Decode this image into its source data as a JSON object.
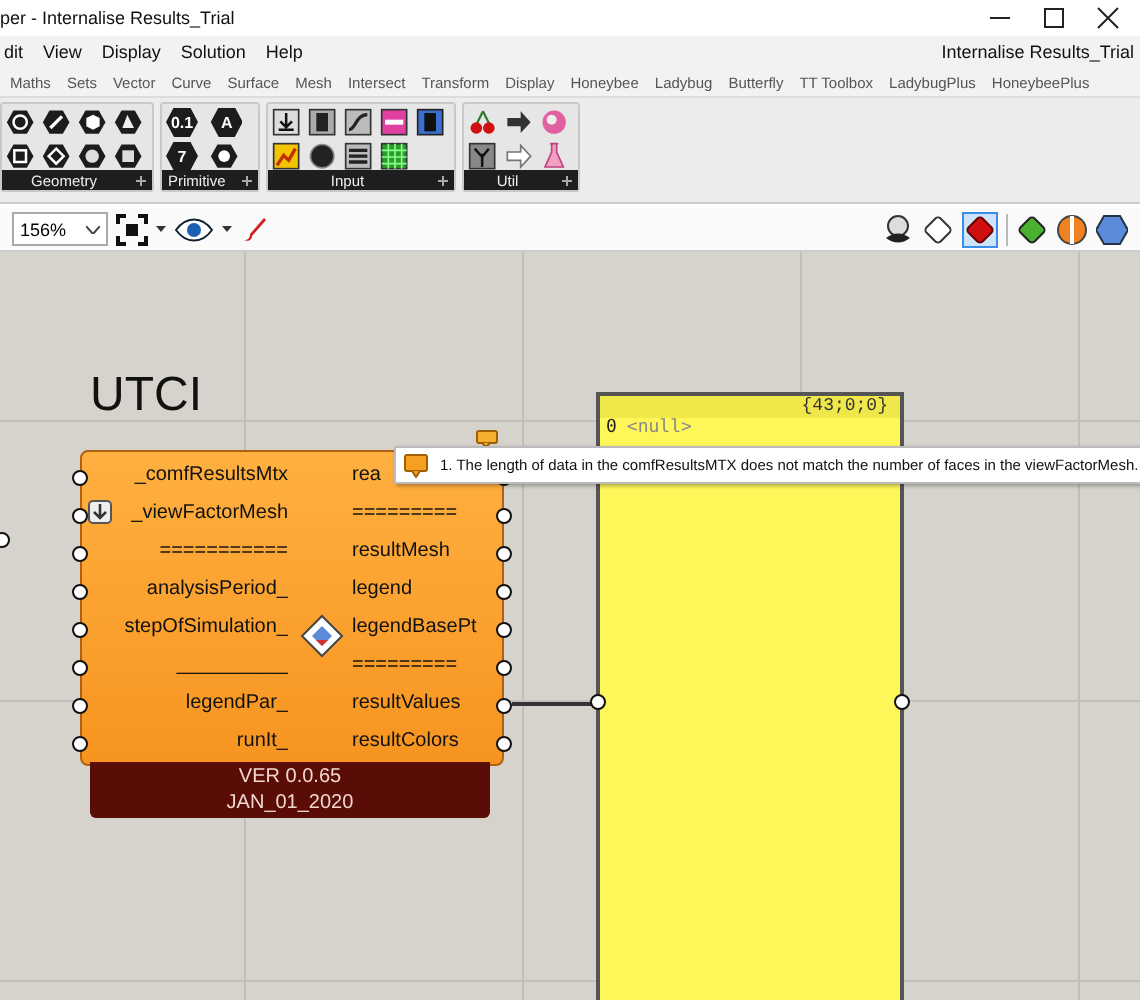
{
  "window": {
    "title": "per - Internalise Results_Trial",
    "document_title": "Internalise Results_Trial"
  },
  "menu": [
    "dit",
    "View",
    "Display",
    "Solution",
    "Help"
  ],
  "tabs": [
    {
      "label": "Maths",
      "selected": false
    },
    {
      "label": "Sets",
      "selected": false
    },
    {
      "label": "Vector",
      "selected": false
    },
    {
      "label": "Curve",
      "selected": false
    },
    {
      "label": "Surface",
      "selected": false
    },
    {
      "label": "Mesh",
      "selected": false
    },
    {
      "label": "Intersect",
      "selected": false
    },
    {
      "label": "Transform",
      "selected": false
    },
    {
      "label": "Display",
      "selected": false
    },
    {
      "label": "Honeybee",
      "selected": false
    },
    {
      "label": "Ladybug",
      "selected": false
    },
    {
      "label": "Butterfly",
      "selected": false
    },
    {
      "label": "TT Toolbox",
      "selected": false
    },
    {
      "label": "LadybugPlus",
      "selected": false
    },
    {
      "label": "HoneybeePlus",
      "selected": false
    }
  ],
  "ribbon": [
    {
      "label": "Geometry",
      "kind": "geometry"
    },
    {
      "label": "Primitive",
      "kind": "primitive",
      "glyphs": [
        "0.1",
        "7",
        "A"
      ]
    },
    {
      "label": "Input",
      "kind": "input"
    },
    {
      "label": "Util",
      "kind": "util"
    }
  ],
  "canvas_toolbar": {
    "zoom": "156%"
  },
  "canvas": {
    "title": "UTCI",
    "component": {
      "inputs": [
        {
          "name": "_comfResultsMtx",
          "flatten": false
        },
        {
          "name": "_viewFactorMesh",
          "flatten": true
        },
        {
          "name": "===========",
          "flatten": false
        },
        {
          "name": "analysisPeriod_",
          "flatten": false
        },
        {
          "name": "stepOfSimulation_",
          "flatten": false
        },
        {
          "name": "__________",
          "flatten": false
        },
        {
          "name": "legendPar_",
          "flatten": false
        },
        {
          "name": "runIt_",
          "flatten": false
        }
      ],
      "outputs": [
        {
          "name": "rea",
          "connected": false
        },
        {
          "name": "=========",
          "connected": false
        },
        {
          "name": "resultMesh",
          "connected": false
        },
        {
          "name": "legend",
          "connected": false
        },
        {
          "name": "legendBasePt",
          "connected": false
        },
        {
          "name": "=========",
          "connected": false
        },
        {
          "name": "resultValues",
          "connected": true
        },
        {
          "name": "resultColors",
          "connected": false
        }
      ],
      "version": "VER 0.0.65",
      "date": "JAN_01_2020"
    },
    "panel": {
      "header": "{43;0;0}",
      "rows": [
        {
          "index": "0",
          "value": "<null>"
        }
      ]
    },
    "tooltip": {
      "text": "1. The length of data in the comfResultsMTX does not match the number of faces in the viewFactorMesh."
    }
  }
}
